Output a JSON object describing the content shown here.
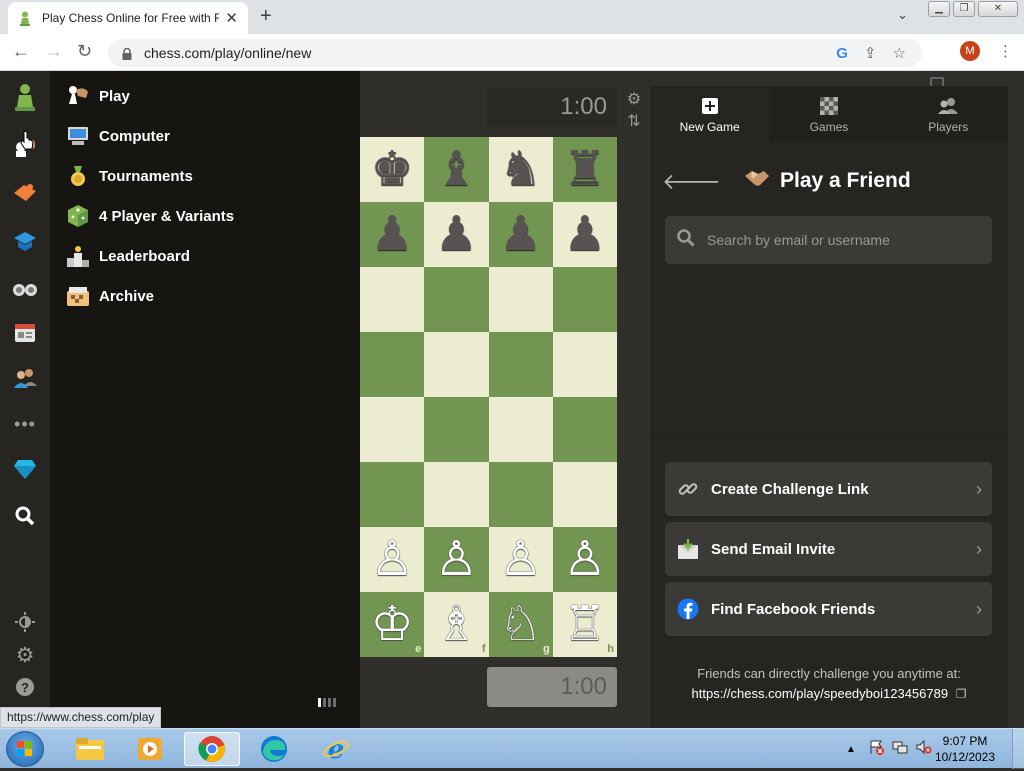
{
  "browser": {
    "tab_title": "Play Chess Online for Free with F",
    "url": "chess.com/play/online/new",
    "profile_initial": "M",
    "status_url": "https://www.chess.com/play"
  },
  "menu": {
    "items": [
      {
        "label": "Play",
        "icon": "pawn-hand-icon"
      },
      {
        "label": "Computer",
        "icon": "computer-icon"
      },
      {
        "label": "Tournaments",
        "icon": "trophy-icon"
      },
      {
        "label": "4 Player & Variants",
        "icon": "dice-icon"
      },
      {
        "label": "Leaderboard",
        "icon": "podium-icon"
      },
      {
        "label": "Archive",
        "icon": "archive-icon"
      }
    ]
  },
  "rail": {
    "icons": [
      "chess-logo-icon",
      "play-icon",
      "puzzles-icon",
      "learn-icon",
      "watch-icon",
      "news-icon",
      "social-icon",
      "more-icon",
      "premium-diamond-icon",
      "search-icon",
      "theme-icon",
      "settings-icon",
      "help-icon"
    ]
  },
  "board": {
    "clock_top": "1:00",
    "clock_bottom": "1:00",
    "files": [
      "e",
      "f",
      "g",
      "h"
    ],
    "rows": [
      [
        "♚",
        "♝",
        "♞",
        "♜"
      ],
      [
        "♟",
        "♟",
        "♟",
        "♟"
      ],
      [
        "",
        "",
        "",
        ""
      ],
      [
        "",
        "",
        "",
        ""
      ],
      [
        "",
        "",
        "",
        ""
      ],
      [
        "",
        "",
        "",
        ""
      ],
      [
        "♙",
        "♙",
        "♙",
        "♙"
      ],
      [
        "♔",
        "♗",
        "♘",
        "♖"
      ]
    ]
  },
  "panel": {
    "tabs": [
      {
        "label": "New Game",
        "icon": "plus-icon",
        "active": true
      },
      {
        "label": "Games",
        "icon": "board-icon",
        "active": false
      },
      {
        "label": "Players",
        "icon": "players-icon",
        "active": false
      }
    ],
    "title": "Play a Friend",
    "search_placeholder": "Search by email or username",
    "options": [
      {
        "label": "Create Challenge Link",
        "icon": "link-icon"
      },
      {
        "label": "Send Email Invite",
        "icon": "email-icon"
      },
      {
        "label": "Find Facebook Friends",
        "icon": "facebook-icon"
      }
    ],
    "friend_text": "Friends can directly challenge you anytime at:",
    "friend_link": "https://chess.com/play/speedyboi123456789"
  },
  "taskbar": {
    "time": "9:07 PM",
    "date": "10/12/2023"
  },
  "colors": {
    "board_light": "#ebecd0",
    "board_dark": "#739552",
    "chess_green": "#81b64c"
  }
}
